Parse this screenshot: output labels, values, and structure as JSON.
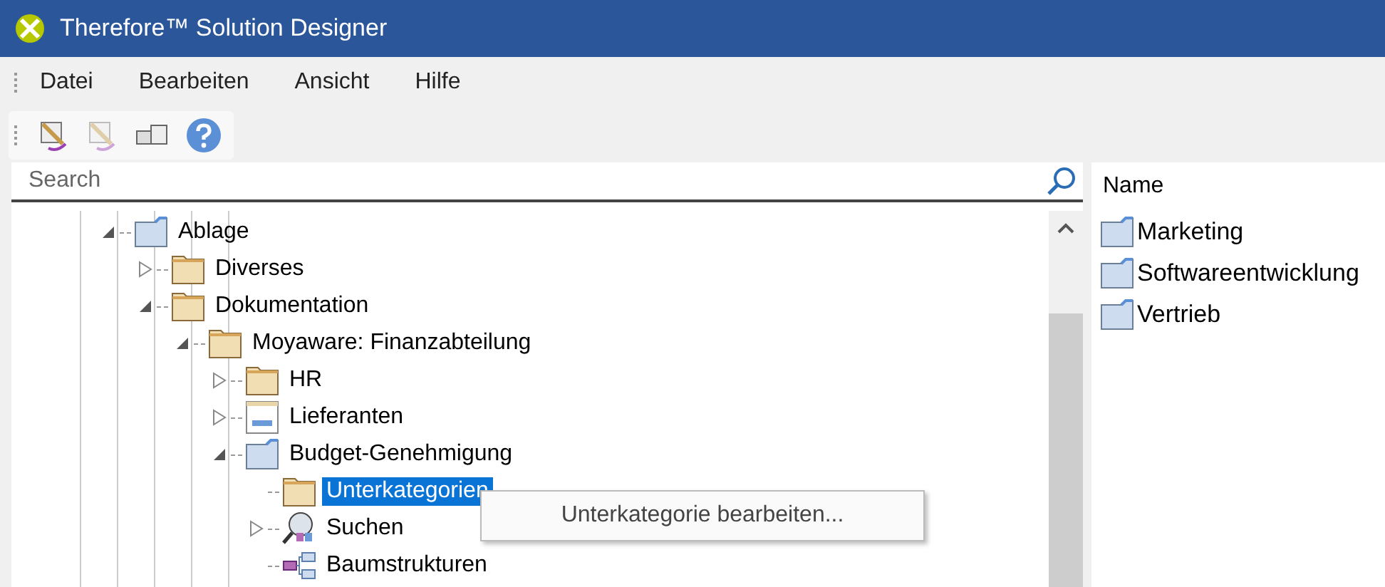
{
  "window": {
    "title": "Therefore™ Solution Designer"
  },
  "menu": [
    "Datei",
    "Bearbeiten",
    "Ansicht",
    "Hilfe"
  ],
  "toolbar": [
    {
      "kind": "designer",
      "disabled": false
    },
    {
      "kind": "designer",
      "disabled": true
    },
    {
      "kind": "translate",
      "disabled": false
    },
    {
      "kind": "help",
      "disabled": false
    }
  ],
  "search": {
    "placeholder": "Search"
  },
  "tree": [
    {
      "label": "Ablage",
      "kind": "category",
      "expanded": true,
      "selected": false,
      "children": [
        {
          "label": "Diverses",
          "kind": "folder",
          "expanded": false,
          "selected": false
        },
        {
          "label": "Dokumentation",
          "kind": "folder",
          "expanded": true,
          "selected": false,
          "children": [
            {
              "label": "Moyaware: Finanzabteilung",
              "kind": "folder",
              "expanded": true,
              "selected": false,
              "children": [
                {
                  "label": "HR",
                  "kind": "folder",
                  "expanded": false,
                  "selected": false
                },
                {
                  "label": "Lieferanten",
                  "kind": "form",
                  "expanded": false,
                  "selected": false
                },
                {
                  "label": "Budget-Genehmigung",
                  "kind": "category",
                  "expanded": true,
                  "selected": false,
                  "children": [
                    {
                      "label": "Unterkategorien",
                      "kind": "folder",
                      "selected": true
                    },
                    {
                      "label": "Suchen",
                      "kind": "search",
                      "expanded": false,
                      "selected": false
                    },
                    {
                      "label": "Baumstrukturen",
                      "kind": "tree",
                      "selected": false
                    }
                  ]
                }
              ]
            }
          ]
        }
      ]
    }
  ],
  "context_menu": [
    "Unterkategorie bearbeiten..."
  ],
  "list": {
    "column": "Name",
    "items": [
      "Marketing",
      "Softwareentwicklung",
      "Vertrieb"
    ]
  }
}
